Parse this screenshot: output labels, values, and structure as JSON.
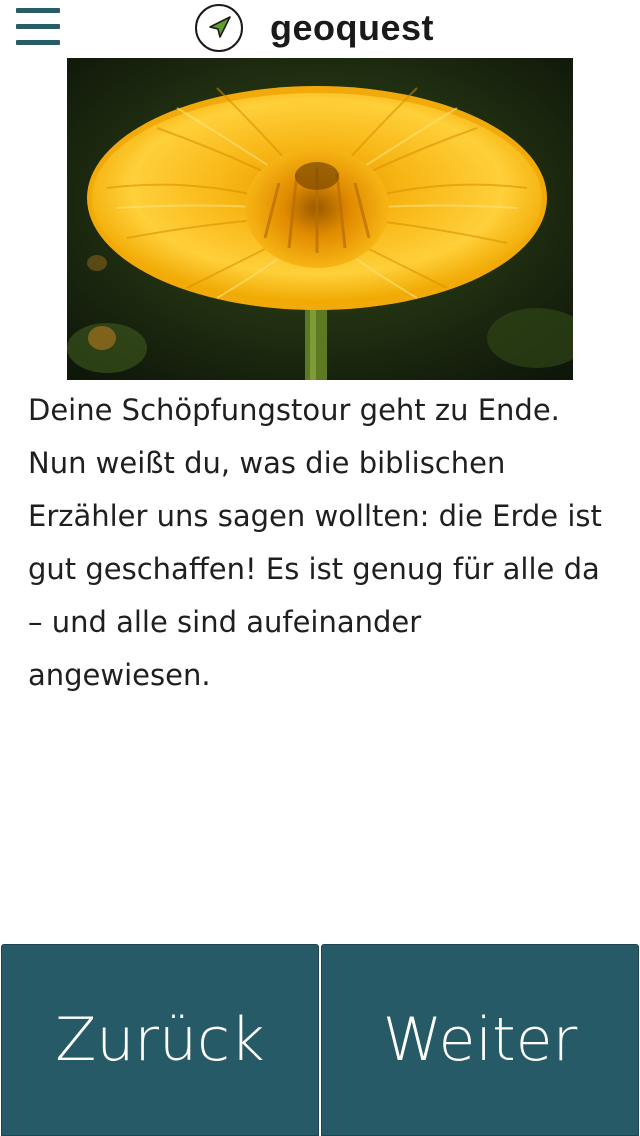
{
  "header": {
    "menu_icon": "hamburger-menu-icon",
    "logo_icon": "navigation-arrow-icon",
    "brand_name": "geoquest"
  },
  "hero_image": {
    "subject": "yellow-orange marigold flower on dark green background"
  },
  "content": {
    "text": "Deine Schöpfungstour geht zu Ende. Nun weißt du, was die biblischen Erzähler uns sagen wollten: die Erde ist gut geschaffen! Es ist genug für alle da – und alle sind aufeinander angewiesen."
  },
  "footer": {
    "back_label": "Zurück",
    "next_label": "Weiter"
  },
  "colors": {
    "accent": "#265a67",
    "menu_icon": "#2a5b69",
    "logo_arrow": "#5f9e2f",
    "button_text": "#ffffff"
  }
}
